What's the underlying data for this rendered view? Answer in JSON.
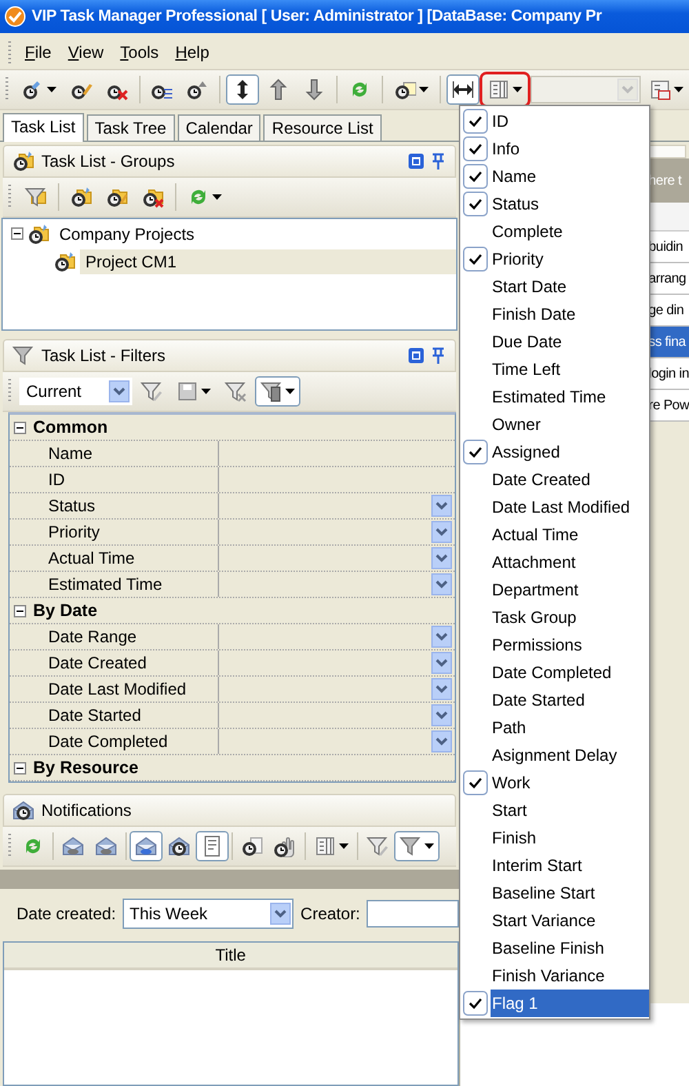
{
  "window": {
    "title": "VIP Task Manager Professional [ User: Administrator ] [DataBase: Company Pr"
  },
  "menu_bar": [
    "File",
    "View",
    "Tools",
    "Help"
  ],
  "main_toolbar": {
    "buttons": [
      {
        "pressed": false,
        "highlighted": false
      },
      {
        "pressed": false,
        "highlighted": false
      },
      {
        "pressed": false,
        "highlighted": false
      },
      {
        "pressed": false,
        "highlighted": false
      },
      {
        "pressed": false,
        "highlighted": false
      },
      {
        "pressed": true,
        "highlighted": false
      },
      {
        "pressed": false,
        "highlighted": false
      },
      {
        "pressed": false,
        "highlighted": false
      },
      {
        "pressed": false,
        "highlighted": false
      },
      {
        "pressed": false,
        "highlighted": false
      },
      {
        "pressed": true,
        "highlighted": false
      },
      {
        "pressed": false,
        "highlighted": true
      },
      {
        "pressed": false,
        "highlighted": false
      }
    ],
    "combo": {
      "disabled": true
    }
  },
  "tabs": [
    {
      "label": "Task List",
      "selected": true
    },
    {
      "label": "Task Tree",
      "selected": false
    },
    {
      "label": "Calendar",
      "selected": false
    },
    {
      "label": "Resource List",
      "selected": false
    }
  ],
  "groups_panel": {
    "title": "Task List - Groups",
    "toolbar": {
      "buttons": [
        {
          "pressed": false
        },
        {
          "pressed": false
        },
        {
          "pressed": false
        },
        {
          "pressed": false
        },
        {
          "pressed": false
        }
      ]
    },
    "tree": [
      {
        "label": "Company Projects",
        "expanded": true,
        "selected": false,
        "children": [
          {
            "label": "Project CM1",
            "selected": true
          }
        ]
      }
    ]
  },
  "filters_panel": {
    "title": "Task List - Filters",
    "toolbar": {
      "filter_combo": {
        "value": "Current"
      },
      "buttons": [
        {
          "pressed": false
        },
        {
          "pressed": false
        },
        {
          "pressed": false
        },
        {
          "pressed": true
        }
      ]
    },
    "categories": [
      {
        "label": "Common",
        "expanded": true,
        "rows": [
          {
            "label": "Name",
            "kind": "text"
          },
          {
            "label": "ID",
            "kind": "text"
          },
          {
            "label": "Status",
            "kind": "dropdown"
          },
          {
            "label": "Priority",
            "kind": "dropdown"
          },
          {
            "label": "Actual Time",
            "kind": "dropdown"
          },
          {
            "label": "Estimated Time",
            "kind": "dropdown"
          }
        ]
      },
      {
        "label": "By Date",
        "expanded": true,
        "rows": [
          {
            "label": "Date Range",
            "kind": "dropdown"
          },
          {
            "label": "Date Created",
            "kind": "dropdown"
          },
          {
            "label": "Date Last Modified",
            "kind": "dropdown"
          },
          {
            "label": "Date Started",
            "kind": "dropdown"
          },
          {
            "label": "Date Completed",
            "kind": "dropdown"
          }
        ]
      },
      {
        "label": "By Resource",
        "expanded": true
      }
    ]
  },
  "notifications_panel": {
    "title": "Notifications",
    "toolbar": {
      "buttons": [
        {
          "pressed": false
        },
        {
          "pressed": false
        },
        {
          "pressed": false
        },
        {
          "pressed": true
        },
        {
          "pressed": false
        },
        {
          "pressed": true
        },
        {
          "pressed": false
        },
        {
          "pressed": false
        },
        {
          "pressed": false
        },
        {
          "pressed": false
        },
        {
          "pressed": true
        }
      ]
    },
    "date_created": {
      "label": "Date created:",
      "value": "This Week"
    },
    "creator": {
      "label": "Creator:"
    },
    "table": {
      "columns": [
        "Title"
      ]
    }
  },
  "task_list_behind": {
    "group_hint": "here t",
    "rows": [
      {
        "text": "buidin",
        "selected": false
      },
      {
        "text": "arrang",
        "selected": false
      },
      {
        "text": "ge din",
        "selected": false
      },
      {
        "text": "ss fina",
        "selected": true
      },
      {
        "text": "login in",
        "selected": false
      },
      {
        "text": "re Pow",
        "selected": false
      }
    ]
  },
  "columns_menu": [
    {
      "label": "ID",
      "checked": true,
      "selected": false
    },
    {
      "label": "Info",
      "checked": true,
      "selected": false
    },
    {
      "label": "Name",
      "checked": true,
      "selected": false
    },
    {
      "label": "Status",
      "checked": true,
      "selected": false
    },
    {
      "label": "Complete",
      "checked": false,
      "selected": false
    },
    {
      "label": "Priority",
      "checked": true,
      "selected": false
    },
    {
      "label": "Start Date",
      "checked": false,
      "selected": false
    },
    {
      "label": "Finish Date",
      "checked": false,
      "selected": false
    },
    {
      "label": "Due Date",
      "checked": false,
      "selected": false
    },
    {
      "label": "Time Left",
      "checked": false,
      "selected": false
    },
    {
      "label": "Estimated Time",
      "checked": false,
      "selected": false
    },
    {
      "label": "Owner",
      "checked": false,
      "selected": false
    },
    {
      "label": "Assigned",
      "checked": true,
      "selected": false
    },
    {
      "label": "Date Created",
      "checked": false,
      "selected": false
    },
    {
      "label": "Date Last Modified",
      "checked": false,
      "selected": false
    },
    {
      "label": "Actual Time",
      "checked": false,
      "selected": false
    },
    {
      "label": "Attachment",
      "checked": false,
      "selected": false
    },
    {
      "label": "Department",
      "checked": false,
      "selected": false
    },
    {
      "label": "Task Group",
      "checked": false,
      "selected": false
    },
    {
      "label": "Permissions",
      "checked": false,
      "selected": false
    },
    {
      "label": "Date Completed",
      "checked": false,
      "selected": false
    },
    {
      "label": "Date Started",
      "checked": false,
      "selected": false
    },
    {
      "label": "Path",
      "checked": false,
      "selected": false
    },
    {
      "label": "Asignment Delay",
      "checked": false,
      "selected": false
    },
    {
      "label": "Work",
      "checked": true,
      "selected": false
    },
    {
      "label": "Start",
      "checked": false,
      "selected": false
    },
    {
      "label": "Finish",
      "checked": false,
      "selected": false
    },
    {
      "label": "Interim Start",
      "checked": false,
      "selected": false
    },
    {
      "label": "Baseline Start",
      "checked": false,
      "selected": false
    },
    {
      "label": "Start Variance",
      "checked": false,
      "selected": false
    },
    {
      "label": "Baseline Finish",
      "checked": false,
      "selected": false
    },
    {
      "label": "Finish Variance",
      "checked": false,
      "selected": false
    },
    {
      "label": "Flag 1",
      "checked": true,
      "selected": true
    }
  ]
}
